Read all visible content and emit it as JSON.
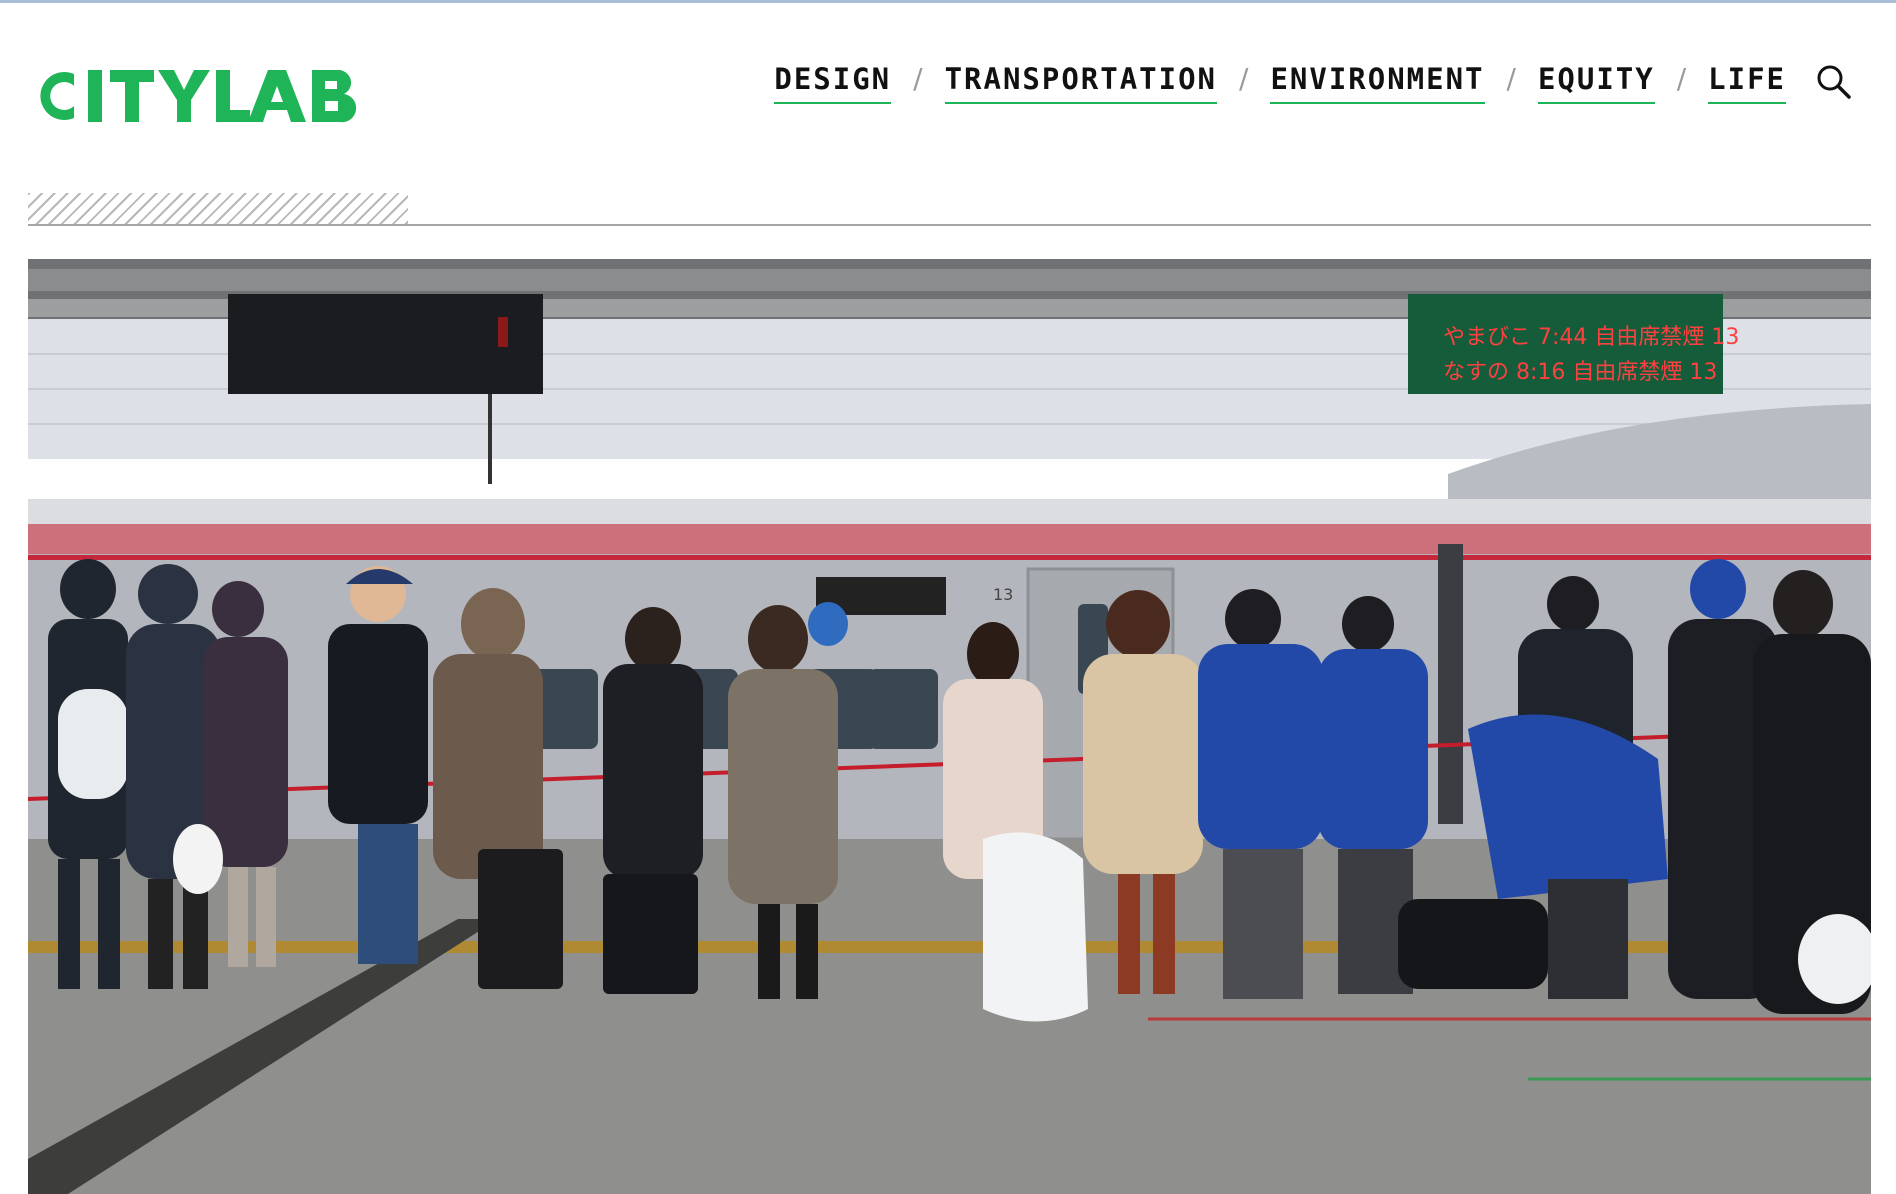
{
  "brand": {
    "logo_text": "CITYLAB",
    "accent_color": "#1fb457"
  },
  "nav": {
    "items": [
      {
        "label": "DESIGN"
      },
      {
        "label": "TRANSPORTATION"
      },
      {
        "label": "ENVIRONMENT"
      },
      {
        "label": "EQUITY"
      },
      {
        "label": "LIFE"
      }
    ],
    "separator": "/",
    "search_icon": "search-icon"
  },
  "hero": {
    "sign_right_row1": "やまびこ 7:44 自由席禁煙 13",
    "sign_right_row2": "なすの 8:16 自由席禁煙 13",
    "car_number": "13"
  }
}
